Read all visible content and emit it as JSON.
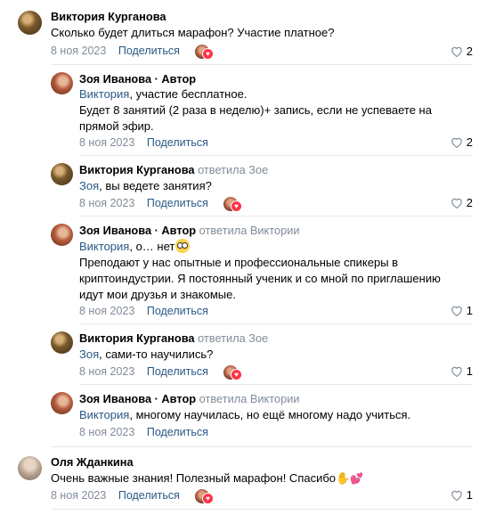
{
  "comments": [
    {
      "author": "Виктория Курганова",
      "replied": "",
      "ref": "",
      "text": "Сколько будет длиться марафон? Участие платное?",
      "date": "8 ноя 2023",
      "share": "Поделиться",
      "likes": "2",
      "liked_by_icon": "avatar-heart"
    },
    {
      "author": "Зоя Иванова · Автор",
      "replied": "",
      "ref": "Виктория",
      "text": ", участие бесплатное.",
      "text2": "Будет 8 занятий (2 раза в неделю)+ запись, если не успеваете на прямой эфир.",
      "date": "8 ноя 2023",
      "share": "Поделиться",
      "likes": "2"
    },
    {
      "author": "Виктория Курганова",
      "replied": "ответила Зое",
      "ref": "Зоя",
      "text": ", вы ведете занятия?",
      "date": "8 ноя 2023",
      "share": "Поделиться",
      "likes": "2"
    },
    {
      "author": "Зоя Иванова · Автор",
      "replied": "ответила Виктории",
      "ref": "Виктория",
      "text": ", о… нет",
      "text2": "Преподают у нас опытные и профессиональные спикеры в криптоиндустрии. Я постоянный ученик и со мной по приглашению идут мои друзья и знакомые.",
      "date": "8 ноя 2023",
      "share": "Поделиться",
      "likes": "1"
    },
    {
      "author": "Виктория Курганова",
      "replied": "ответила Зое",
      "ref": "Зоя",
      "text": ", сами-то научились?",
      "date": "8 ноя 2023",
      "share": "Поделиться",
      "likes": "1"
    },
    {
      "author": "Зоя Иванова · Автор",
      "replied": "ответила Виктории",
      "ref": "Виктория",
      "text": ", многому научилась, но ещё многому надо учиться.",
      "date": "8 ноя 2023",
      "share": "Поделиться"
    },
    {
      "author": "Оля Жданкина",
      "replied": "",
      "ref": "",
      "text": "Очень важные знания! Полезный марафон! Спасибо",
      "date": "8 ноя 2023",
      "share": "Поделиться",
      "likes": "1"
    }
  ],
  "colors": {
    "link": "#2a5885",
    "muted": "#818c99",
    "divider": "#e7e8ec",
    "like": "#ff3347"
  }
}
